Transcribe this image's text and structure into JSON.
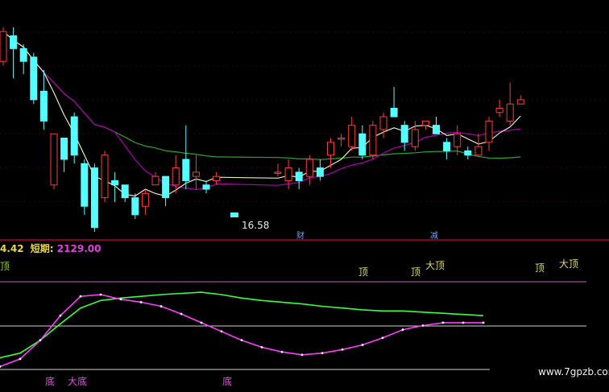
{
  "header": {
    "value": "4.42",
    "short_label": "短期:",
    "short_value": "2129.00"
  },
  "price_annotation": "16.58",
  "event_markers": [
    "财",
    "减"
  ],
  "watermark": "www.7gpzb.com",
  "signal_labels": {
    "top": "顶",
    "bottom": "底",
    "big_top": "大顶",
    "big_bottom": "大底"
  },
  "colors": {
    "up": "#ff3b3b",
    "down": "#54ffff",
    "ma_short": "#e8e8c8",
    "ma_mid": "#b000b0",
    "ma_long": "#2aa62a",
    "osc_fast": "#ff3cff",
    "osc_slow": "#3aff3a",
    "divider": "#b0003a"
  },
  "chart_data": {
    "type": "candlestick",
    "price_range": [
      15.9,
      21.0
    ],
    "candles": [
      [
        19.9,
        20.6,
        20.7,
        19.8
      ],
      [
        20.5,
        20.2,
        20.7,
        19.5
      ],
      [
        20.2,
        19.9,
        20.3,
        19.6
      ],
      [
        20.0,
        19.0,
        20.1,
        18.9
      ],
      [
        19.2,
        18.5,
        19.7,
        18.3
      ],
      [
        17.0,
        18.2,
        18.2,
        16.9
      ],
      [
        18.1,
        17.6,
        18.1,
        17.3
      ],
      [
        18.6,
        17.7,
        18.7,
        17.5
      ],
      [
        17.5,
        16.5,
        17.6,
        16.3
      ],
      [
        17.4,
        16.0,
        17.5,
        15.9
      ],
      [
        16.7,
        17.7,
        17.8,
        16.6
      ],
      [
        17.1,
        17.0,
        17.3,
        16.6
      ],
      [
        17.0,
        16.7,
        17.0,
        16.6
      ],
      [
        16.7,
        16.3,
        16.8,
        16.2
      ],
      [
        16.5,
        16.8,
        16.9,
        16.3
      ],
      [
        17.0,
        17.2,
        17.3,
        17.0
      ],
      [
        17.2,
        16.7,
        17.2,
        16.5
      ],
      [
        17.0,
        17.4,
        17.7,
        16.8
      ],
      [
        17.6,
        17.1,
        18.4,
        16.9
      ],
      [
        17.2,
        17.3,
        17.7,
        16.9
      ],
      [
        17.0,
        16.9,
        17.1,
        16.8
      ],
      [
        17.1,
        17.2,
        17.3,
        17.0
      ],
      [
        17.3,
        17.3,
        17.5,
        17.2
      ],
      [
        17.1,
        17.4,
        17.6,
        16.9
      ],
      [
        17.3,
        17.1,
        17.4,
        16.9
      ],
      [
        17.2,
        17.6,
        17.7,
        17.0
      ],
      [
        17.4,
        17.2,
        17.6,
        17.1
      ],
      [
        17.7,
        18.0,
        18.1,
        17.4
      ],
      [
        18.1,
        18.1,
        18.2,
        17.9
      ],
      [
        17.9,
        18.4,
        18.6,
        17.8
      ],
      [
        18.2,
        17.7,
        18.4,
        17.6
      ],
      [
        17.7,
        18.4,
        18.5,
        17.6
      ],
      [
        18.3,
        18.6,
        18.7,
        18.1
      ],
      [
        18.8,
        18.6,
        19.3,
        18.6
      ],
      [
        18.4,
        18.0,
        18.5,
        17.8
      ],
      [
        17.9,
        18.3,
        18.5,
        17.8
      ],
      [
        18.4,
        18.5,
        18.5,
        18.3
      ],
      [
        18.4,
        18.2,
        18.6,
        18.2
      ],
      [
        18.0,
        17.8,
        18.1,
        17.6
      ],
      [
        17.9,
        18.2,
        18.4,
        17.7
      ],
      [
        17.8,
        17.7,
        17.9,
        17.6
      ],
      [
        17.7,
        17.9,
        18.2,
        17.7
      ],
      [
        18.0,
        18.5,
        18.6,
        17.8
      ],
      [
        18.7,
        18.8,
        19.0,
        18.6
      ],
      [
        18.5,
        18.9,
        19.4,
        18.4
      ],
      [
        18.9,
        19.0,
        19.1,
        18.9
      ]
    ],
    "oscillator": {
      "fast": [
        55,
        68,
        100,
        142,
        175,
        178,
        170,
        165,
        158,
        145,
        130,
        115,
        100,
        88,
        80,
        75,
        78,
        84,
        92,
        104,
        118,
        125,
        130,
        130,
        130
      ],
      "slow": [
        70,
        78,
        100,
        128,
        155,
        168,
        172,
        175,
        178,
        180,
        182,
        178,
        172,
        168,
        165,
        162,
        158,
        155,
        152,
        150,
        150,
        148,
        146,
        144,
        142
      ]
    }
  }
}
